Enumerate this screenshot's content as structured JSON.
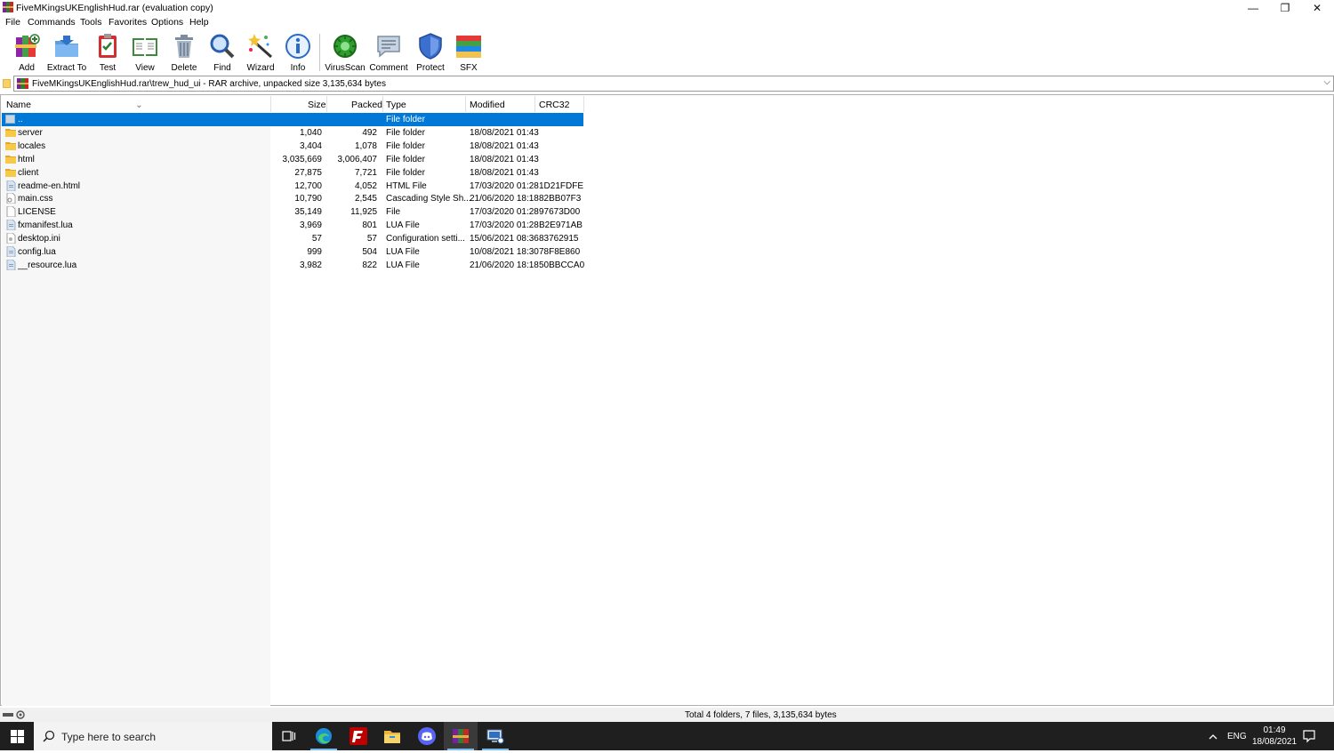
{
  "window": {
    "title": "FiveMKingsUKEnglishHud.rar (evaluation copy)",
    "controls": {
      "minimize": "—",
      "restore": "❐",
      "close": "✕"
    }
  },
  "menu": [
    "File",
    "Commands",
    "Tools",
    "Favorites",
    "Options",
    "Help"
  ],
  "toolbar": [
    {
      "label": "Add",
      "icon": "add-books-icon"
    },
    {
      "label": "Extract To",
      "icon": "extract-folder-icon"
    },
    {
      "label": "Test",
      "icon": "test-clipboard-icon"
    },
    {
      "label": "View",
      "icon": "view-book-icon"
    },
    {
      "label": "Delete",
      "icon": "delete-bin-icon"
    },
    {
      "label": "Find",
      "icon": "find-magnifier-icon"
    },
    {
      "label": "Wizard",
      "icon": "wizard-wand-icon"
    },
    {
      "label": "Info",
      "icon": "info-icon"
    },
    {
      "label": "VirusScan",
      "icon": "virus-scan-icon"
    },
    {
      "label": "Comment",
      "icon": "comment-icon"
    },
    {
      "label": "Protect",
      "icon": "protect-shield-icon"
    },
    {
      "label": "SFX",
      "icon": "sfx-books-icon"
    }
  ],
  "address": {
    "path": "FiveMKingsUKEnglishHud.rar\\trew_hud_ui - RAR archive, unpacked size 3,135,634 bytes"
  },
  "columns": {
    "name": "Name",
    "size": "Size",
    "packed": "Packed",
    "type": "Type",
    "modified": "Modified",
    "crc": "CRC32"
  },
  "rows": [
    {
      "name": "..",
      "size": "",
      "packed": "",
      "type": "File folder",
      "modified": "",
      "crc": "",
      "kind": "up",
      "selected": true
    },
    {
      "name": "server",
      "size": "1,040",
      "packed": "492",
      "type": "File folder",
      "modified": "18/08/2021 01:43",
      "crc": "",
      "kind": "folder"
    },
    {
      "name": "locales",
      "size": "3,404",
      "packed": "1,078",
      "type": "File folder",
      "modified": "18/08/2021 01:43",
      "crc": "",
      "kind": "folder"
    },
    {
      "name": "html",
      "size": "3,035,669",
      "packed": "3,006,407",
      "type": "File folder",
      "modified": "18/08/2021 01:43",
      "crc": "",
      "kind": "folder"
    },
    {
      "name": "client",
      "size": "27,875",
      "packed": "7,721",
      "type": "File folder",
      "modified": "18/08/2021 01:43",
      "crc": "",
      "kind": "folder"
    },
    {
      "name": "readme-en.html",
      "size": "12,700",
      "packed": "4,052",
      "type": "HTML File",
      "modified": "17/03/2020 01:28",
      "crc": "1D21FDFE",
      "kind": "file"
    },
    {
      "name": "main.css",
      "size": "10,790",
      "packed": "2,545",
      "type": "Cascading Style Sh...",
      "modified": "21/06/2020 18:18",
      "crc": "82BB07F3",
      "kind": "css"
    },
    {
      "name": "LICENSE",
      "size": "35,149",
      "packed": "11,925",
      "type": "File",
      "modified": "17/03/2020 01:28",
      "crc": "97673D00",
      "kind": "blank"
    },
    {
      "name": "fxmanifest.lua",
      "size": "3,969",
      "packed": "801",
      "type": "LUA File",
      "modified": "17/03/2020 01:28",
      "crc": "B2E971AB",
      "kind": "file"
    },
    {
      "name": "desktop.ini",
      "size": "57",
      "packed": "57",
      "type": "Configuration setti...",
      "modified": "15/06/2021 08:36",
      "crc": "83762915",
      "kind": "ini"
    },
    {
      "name": "config.lua",
      "size": "999",
      "packed": "504",
      "type": "LUA File",
      "modified": "10/08/2021 18:30",
      "crc": "78F8E860",
      "kind": "file"
    },
    {
      "name": "__resource.lua",
      "size": "3,982",
      "packed": "822",
      "type": "LUA File",
      "modified": "21/06/2020 18:18",
      "crc": "50BBCCA0",
      "kind": "file"
    }
  ],
  "status": {
    "summary": "Total 4 folders, 7 files, 3,135,634 bytes"
  },
  "taskbar": {
    "search_placeholder": "Type here to search",
    "language": "ENG",
    "time": "01:49",
    "date": "18/08/2021"
  },
  "colors": {
    "selection": "#0078d7",
    "taskbar": "#1f1f1f",
    "folder": "#f7c948"
  }
}
